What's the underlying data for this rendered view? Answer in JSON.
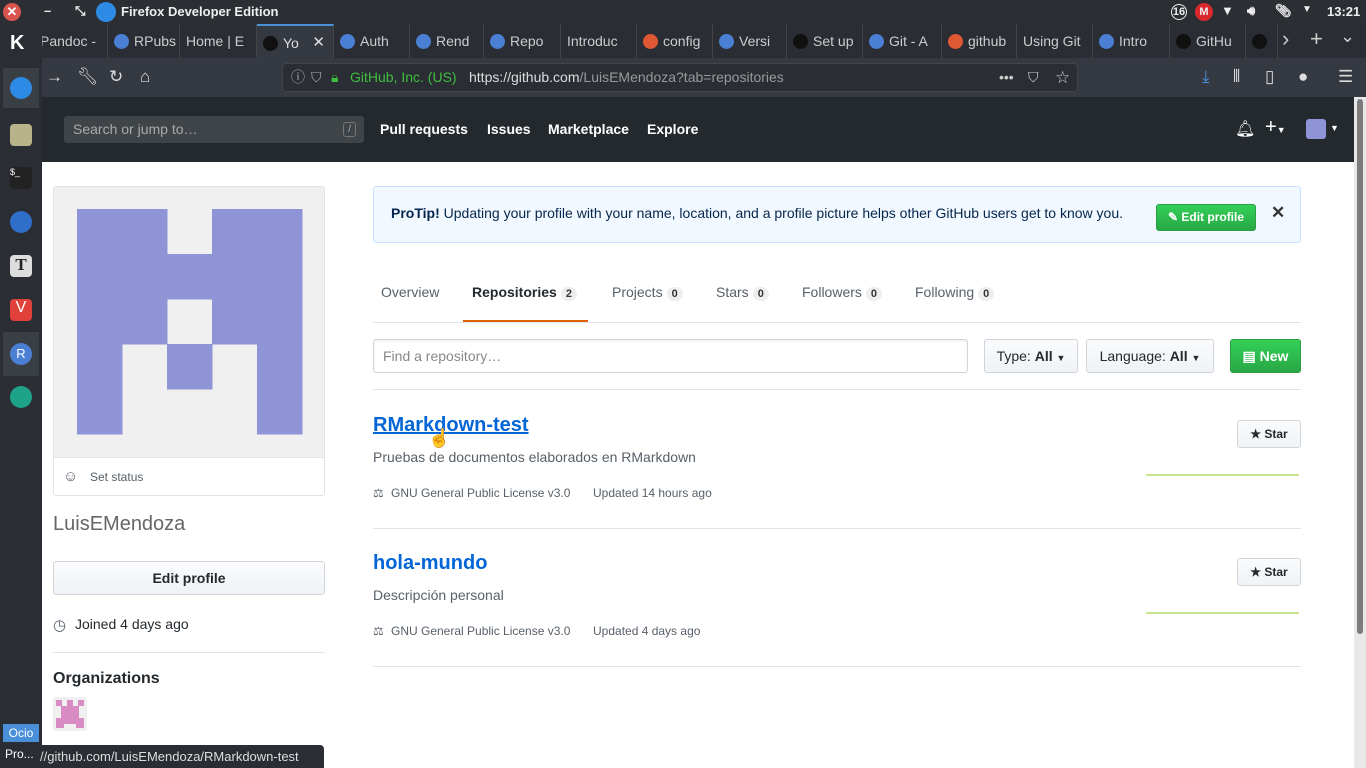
{
  "window": {
    "title": "Firefox Developer Edition",
    "clock": "13:21",
    "tray_badge": "16"
  },
  "tabs": [
    {
      "label": "Pandoc - "
    },
    {
      "label": "RPubs"
    },
    {
      "label": "Home | E"
    },
    {
      "label": "Yo"
    },
    {
      "label": "Auth"
    },
    {
      "label": "Rend"
    },
    {
      "label": "Repo"
    },
    {
      "label": "Introduc"
    },
    {
      "label": "config"
    },
    {
      "label": "Versi"
    },
    {
      "label": "Set up"
    },
    {
      "label": "Git - A"
    },
    {
      "label": "github"
    },
    {
      "label": "Using Git"
    },
    {
      "label": "Intro"
    },
    {
      "label": "GitHu"
    },
    {
      "label": ""
    }
  ],
  "urlbar": {
    "identity": "GitHub, Inc. (US)",
    "url_host": "https://github.com",
    "url_path": "/LuisEMendoza?tab=repositories"
  },
  "github": {
    "search_placeholder": "Search or jump to…",
    "search_key": "/",
    "nav": [
      "Pull requests",
      "Issues",
      "Marketplace",
      "Explore"
    ]
  },
  "profile": {
    "set_status": "Set status",
    "username": "LuisEMendoza",
    "edit_profile": "Edit profile",
    "joined": "Joined 4 days ago",
    "organizations": "Organizations"
  },
  "protip": {
    "label": "ProTip!",
    "text": " Updating your profile with your name, location, and a profile picture helps other GitHub users get to know you.",
    "button": "Edit profile"
  },
  "usertabs": [
    {
      "label": "Overview"
    },
    {
      "label": "Repositories",
      "count": "2"
    },
    {
      "label": "Projects",
      "count": "0"
    },
    {
      "label": "Stars",
      "count": "0"
    },
    {
      "label": "Followers",
      "count": "0"
    },
    {
      "label": "Following",
      "count": "0"
    }
  ],
  "filter": {
    "placeholder": "Find a repository…",
    "type_label": "Type:",
    "type_value": "All",
    "lang_label": "Language:",
    "lang_value": "All",
    "new": "New"
  },
  "repos": [
    {
      "name": "RMarkdown-test",
      "description": "Pruebas de documentos elaborados en RMarkdown",
      "license": "GNU General Public License v3.0",
      "updated": "Updated 14 hours ago",
      "star": "Star"
    },
    {
      "name": "hola-mundo",
      "description": "Descripción personal",
      "license": "GNU General Public License v3.0",
      "updated": "Updated 4 days ago",
      "star": "Star"
    }
  ],
  "statusbar": "//github.com/LuisEMendoza/RMarkdown-test",
  "taskbar": {
    "item1": "Ocio",
    "item2": "Pro..."
  },
  "colors": {
    "accent": "#0366d6",
    "green": "#28a745",
    "identicon": "#8f94d6",
    "org": "#d98bc4"
  }
}
